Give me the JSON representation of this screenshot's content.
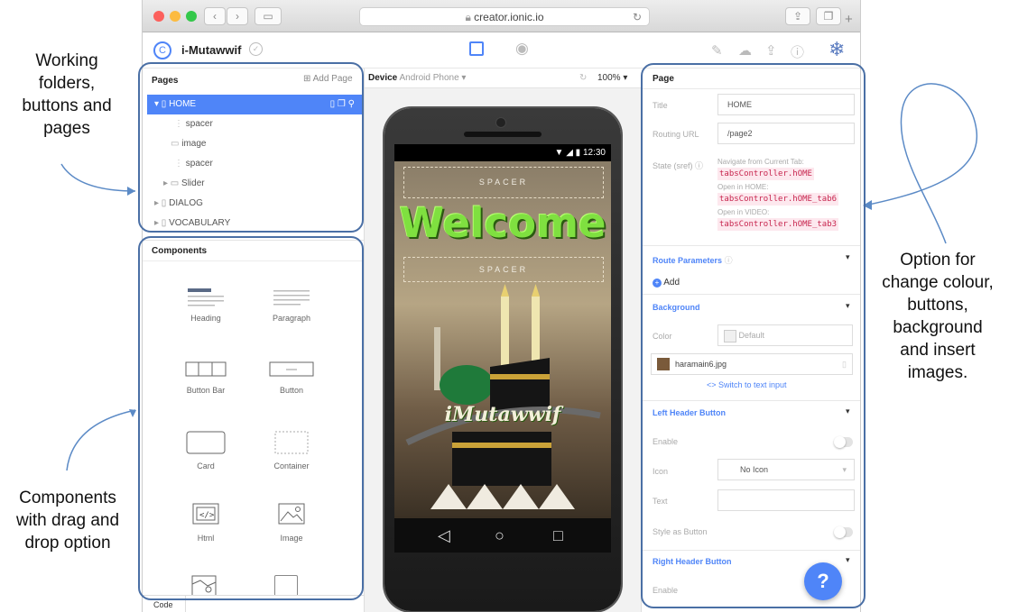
{
  "annotations": {
    "left_top": "Working\nfolders,\nbuttons and\npages",
    "left_bottom": "Components\nwith drag and\ndrop option",
    "right": "Option for\nchange colour,\nbuttons,\nbackground\nand insert\nimages."
  },
  "browser": {
    "url": "creator.ionic.io"
  },
  "app": {
    "name": "i-Mutawwif"
  },
  "pages": {
    "title": "Pages",
    "add_label": "Add Page",
    "items": [
      {
        "label": "HOME"
      },
      {
        "label": "spacer"
      },
      {
        "label": "image"
      },
      {
        "label": "spacer"
      },
      {
        "label": "Slider"
      },
      {
        "label": "DIALOG"
      },
      {
        "label": "VOCABULARY"
      }
    ]
  },
  "components": {
    "title": "Components",
    "items": [
      {
        "label": "Heading"
      },
      {
        "label": "Paragraph"
      },
      {
        "label": "Button Bar"
      },
      {
        "label": "Button"
      },
      {
        "label": "Card"
      },
      {
        "label": "Container"
      },
      {
        "label": "Html"
      },
      {
        "label": "Image"
      }
    ]
  },
  "device": {
    "label": "Device",
    "name": "Android Phone",
    "zoom": "100%",
    "time": "12:30"
  },
  "screen": {
    "spacer_top": "SPACER",
    "welcome": "Welcome",
    "spacer_bottom": "SPACER",
    "logo": "iMutawwif"
  },
  "bottom": {
    "code": "Code"
  },
  "props": {
    "title": "Page",
    "title_label": "Title",
    "title_value": "HOME",
    "routing_label": "Routing URL",
    "routing_value": "/page2",
    "state_label": "State (sref)",
    "nav_current": "Navigate from Current Tab:",
    "nav_current_code": "tabsController.hOME",
    "open_home": "Open in HOME:",
    "open_home_code": "tabsController.hOME_tab6",
    "open_video": "Open in VIDEO:",
    "open_video_code": "tabsController.hOME_tab3",
    "route_params": "Route Parameters",
    "add": "Add",
    "background": "Background",
    "color_label": "Color",
    "color_value": "Default",
    "bg_image": "haramain6.jpg",
    "switch": "<> Switch to text input",
    "left_header": "Left Header Button",
    "enable": "Enable",
    "icon_label": "Icon",
    "icon_value": "No Icon",
    "text_label": "Text",
    "style_label": "Style as Button",
    "right_header": "Right Header Button",
    "enable2": "Enable"
  },
  "colors": {
    "accent": "#4f85f8",
    "outline": "#4a6fa5",
    "code": "#c7254e"
  }
}
